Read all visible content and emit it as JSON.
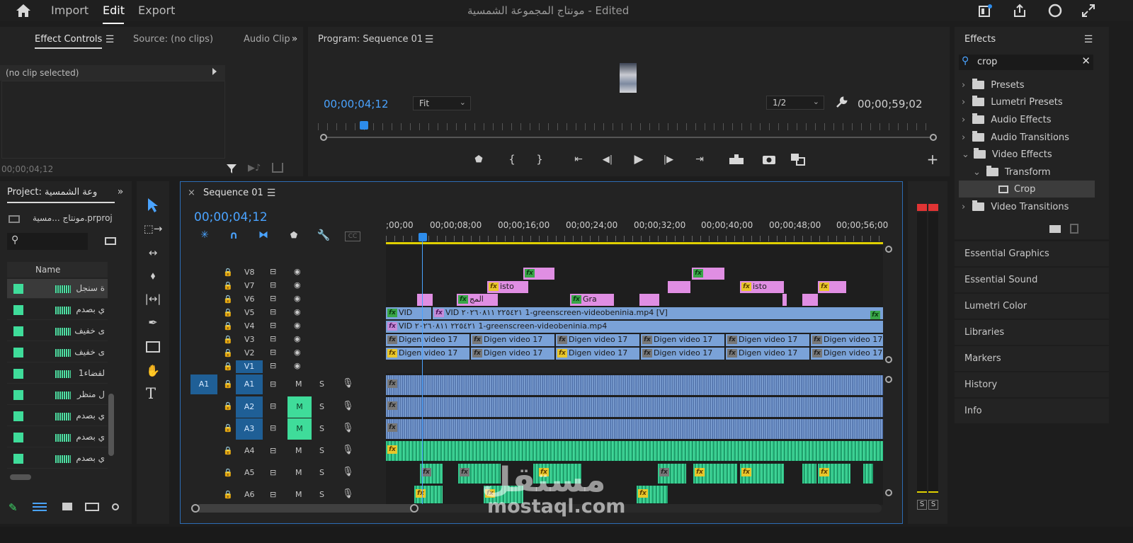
{
  "topbar": {
    "nav": [
      "Import",
      "Edit",
      "Export"
    ],
    "title": "مونتاج المجموعة الشمسية",
    "title_suffix": "- Edited"
  },
  "source_panel": {
    "tabs": [
      "Effect Controls",
      "Source: (no clips)",
      "Audio Clip"
    ],
    "no_clip": "(no clip selected)",
    "timecode": "00;00;04;12"
  },
  "program": {
    "title": "Program: Sequence 01",
    "timecode": "00;00;04;12",
    "fit": "Fit",
    "resolution": "1/2",
    "duration": "00;00;59;02"
  },
  "effects": {
    "title": "Effects",
    "search": "crop",
    "tree": [
      {
        "label": "Presets",
        "icon": "star-folder-icon"
      },
      {
        "label": "Lumetri Presets",
        "icon": "star-folder-icon"
      },
      {
        "label": "Audio Effects",
        "icon": "folder-icon"
      },
      {
        "label": "Audio Transitions",
        "icon": "folder-icon"
      },
      {
        "label": "Video Effects",
        "icon": "folder-icon"
      },
      {
        "label": "Transform",
        "icon": "folder-icon"
      },
      {
        "label": "Crop",
        "icon": "crop-effect-icon"
      },
      {
        "label": "Video Transitions",
        "icon": "folder-icon"
      }
    ],
    "panels": [
      "Essential Graphics",
      "Essential Sound",
      "Lumetri Color",
      "Libraries",
      "Markers",
      "History",
      "Info"
    ]
  },
  "project": {
    "tab": "Project:",
    "tab_name": "وعة الشمسية",
    "file": "مونتاج ...مسية.prproj",
    "column": "Name",
    "items": [
      "ة سنجل",
      "ي بصدم",
      "ى خفيف",
      "ى خفيف",
      "لفضاء1",
      "ل منظر",
      "ي بصدم",
      "ي بصدم",
      "ي بصدم"
    ]
  },
  "timeline": {
    "tab": "Sequence 01",
    "timecode": "00;00;04;12",
    "ruler": [
      ";00;00",
      "00;00;08;00",
      "00;00;16;00",
      "00;00;24;00",
      "00;00;32;00",
      "00;00;40;00",
      "00;00;48;00",
      "00;00;56;00"
    ],
    "video_tracks": [
      "V8",
      "V7",
      "V6",
      "V5",
      "V4",
      "V3",
      "V2",
      "V1"
    ],
    "audio_tracks": [
      "A1",
      "A2",
      "A3",
      "A4",
      "A5",
      "A6"
    ],
    "source_patch": "A1",
    "mute": "M",
    "solo": "S",
    "clip_texts": {
      "v7a": "isto",
      "v7b": "isto",
      "v6a": "المج",
      "v6b": "Gra",
      "v5a": "VID",
      "v5b": "VID  ٢٢٥٤٢١  ٢٠٢٦٠٨١١  1-greenscreen-videobeninia.mp4 [V]",
      "v4": "VID  ٢٢٥٤٢١  ٢٠٢٦٠٨١١  1-greenscreen-videobeninia.mp4",
      "digen": "Digen  video  17"
    }
  },
  "meter": {
    "solo_left": "S",
    "solo_right": "S"
  },
  "watermark": {
    "text": "mostaql.com",
    "logo": "مستقل"
  },
  "colors": {
    "accent": "#2d8ceb",
    "audio_green": "#3fdc9a",
    "video_blue": "#7aa2d8",
    "video_pink": "#e08ee3"
  }
}
